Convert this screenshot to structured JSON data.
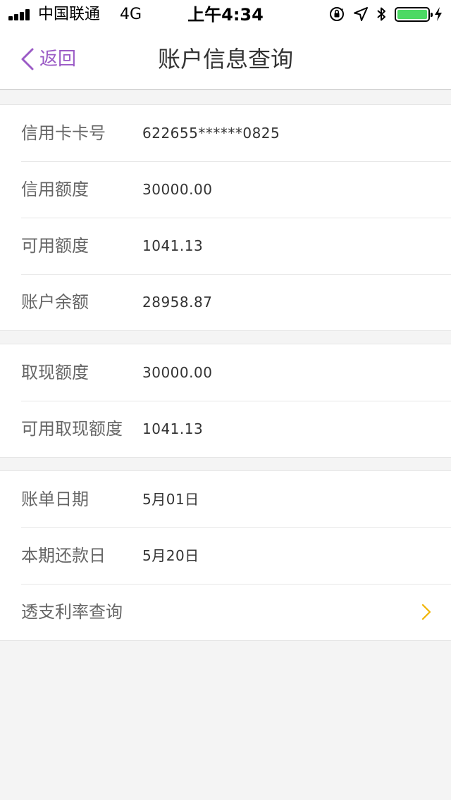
{
  "status_bar": {
    "carrier": "中国联通",
    "network": "4G",
    "time": "上午4:34",
    "battery_color": "#4cd964"
  },
  "nav": {
    "back_label": "返回",
    "title": "账户信息查询",
    "accent_color": "#9b5bc6"
  },
  "groups": [
    {
      "rows": [
        {
          "label": "信用卡卡号",
          "value": "622655******0825"
        },
        {
          "label": "信用额度",
          "value": "30000.00"
        },
        {
          "label": "可用额度",
          "value": "1041.13"
        },
        {
          "label": "账户余额",
          "value": "28958.87"
        }
      ]
    },
    {
      "rows": [
        {
          "label": "取现额度",
          "value": "30000.00"
        },
        {
          "label": "可用取现额度",
          "value": "1041.13"
        }
      ]
    },
    {
      "rows": [
        {
          "label": "账单日期",
          "value": "5月01日"
        },
        {
          "label": "本期还款日",
          "value": "5月20日"
        },
        {
          "label": "透支利率查询",
          "value": ""
        }
      ]
    }
  ],
  "icons": {
    "back": "chevron-left-icon",
    "link": "chevron-right-icon",
    "link_color": "#f0b400"
  }
}
